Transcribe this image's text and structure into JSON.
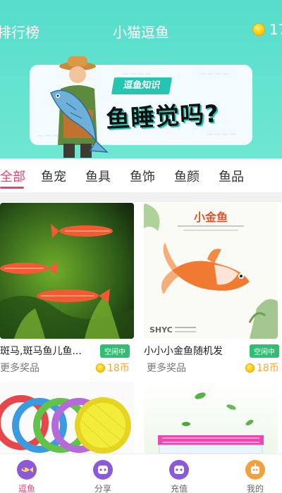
{
  "header": {
    "left_link": "排行榜",
    "title": "小猫逗鱼",
    "coin_count": "17"
  },
  "banner": {
    "tag": "逗鱼知识",
    "headline": "鱼睡觉吗?"
  },
  "tabs": [
    {
      "label": "全部",
      "active": true
    },
    {
      "label": "鱼宠",
      "active": false
    },
    {
      "label": "鱼具",
      "active": false
    },
    {
      "label": "鱼饰",
      "active": false
    },
    {
      "label": "鱼颜",
      "active": false
    },
    {
      "label": "鱼品",
      "active": false
    }
  ],
  "products": [
    {
      "name": "斑马,斑马鱼儿鱼...",
      "badge": "空闲中",
      "sub": "更多奖品",
      "price": "18币",
      "image": "zebrafish-photo"
    },
    {
      "name": "小小小金鱼随机发",
      "badge": "空闲中",
      "sub": "更多奖品",
      "price": "18币",
      "image": "goldfish-photo",
      "image_text": {
        "title": "小金鱼",
        "brand": "SHYC"
      }
    },
    {
      "image": "fishing-nets-photo"
    },
    {
      "image": "fish-tank-photo"
    }
  ],
  "bottom_nav": [
    {
      "label": "逗鱼",
      "icon": "fish-icon",
      "active": true
    },
    {
      "label": "分享",
      "icon": "share-icon",
      "active": false
    },
    {
      "label": "充值",
      "icon": "recharge-icon",
      "active": false
    },
    {
      "label": "我的",
      "icon": "robot-profile-icon",
      "active": false
    }
  ],
  "colors": {
    "header_teal": "#5edfcd",
    "accent_pink": "#ee3f6d",
    "badge_green": "#2fbe73",
    "price_orange": "#f0a83a"
  }
}
